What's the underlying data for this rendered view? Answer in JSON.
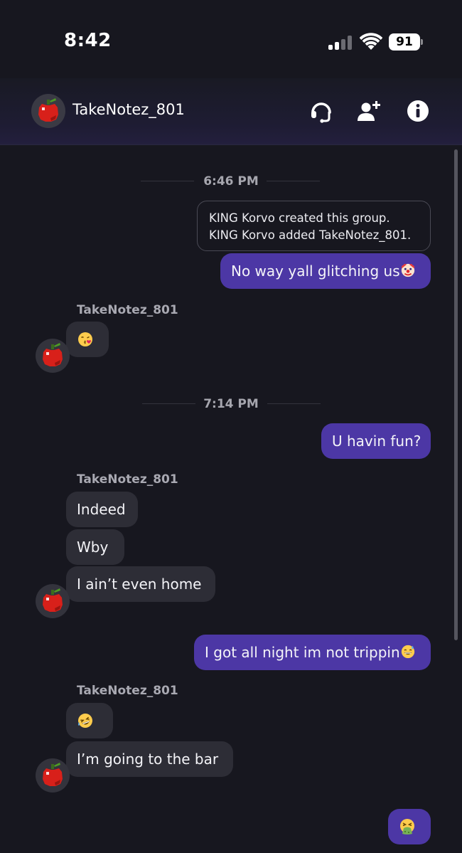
{
  "status_bar": {
    "time": "8:42",
    "battery": "91"
  },
  "header": {
    "title": "TakeNotez_801"
  },
  "messages": {
    "ts1": "6:46 PM",
    "system_line1": "KING Korvo created this group.",
    "system_line2": "KING Korvo added TakeNotez_801.",
    "m1": "No way yall glitching us",
    "sender1": "TakeNotez_801",
    "ts2": "7:14 PM",
    "m3": "U havin fun?",
    "sender2": "TakeNotez_801",
    "m4": "Indeed",
    "m5": "Wby",
    "m6": "I ain’t even home",
    "m7": "I got all night im not trippin",
    "sender3": "TakeNotez_801",
    "m9": "I’m going to the bar"
  },
  "colors": {
    "background": "#17171f",
    "outgoing_bubble": "#4c37a5",
    "incoming_bubble": "#2d2d36"
  },
  "icons": [
    "headset-icon",
    "add-user-icon",
    "info-icon",
    "apple-avatar-icon",
    "clown-emoji",
    "kiss-emoji",
    "laughing-emoji",
    "sweat-smile-emoji",
    "vomit-emoji"
  ]
}
